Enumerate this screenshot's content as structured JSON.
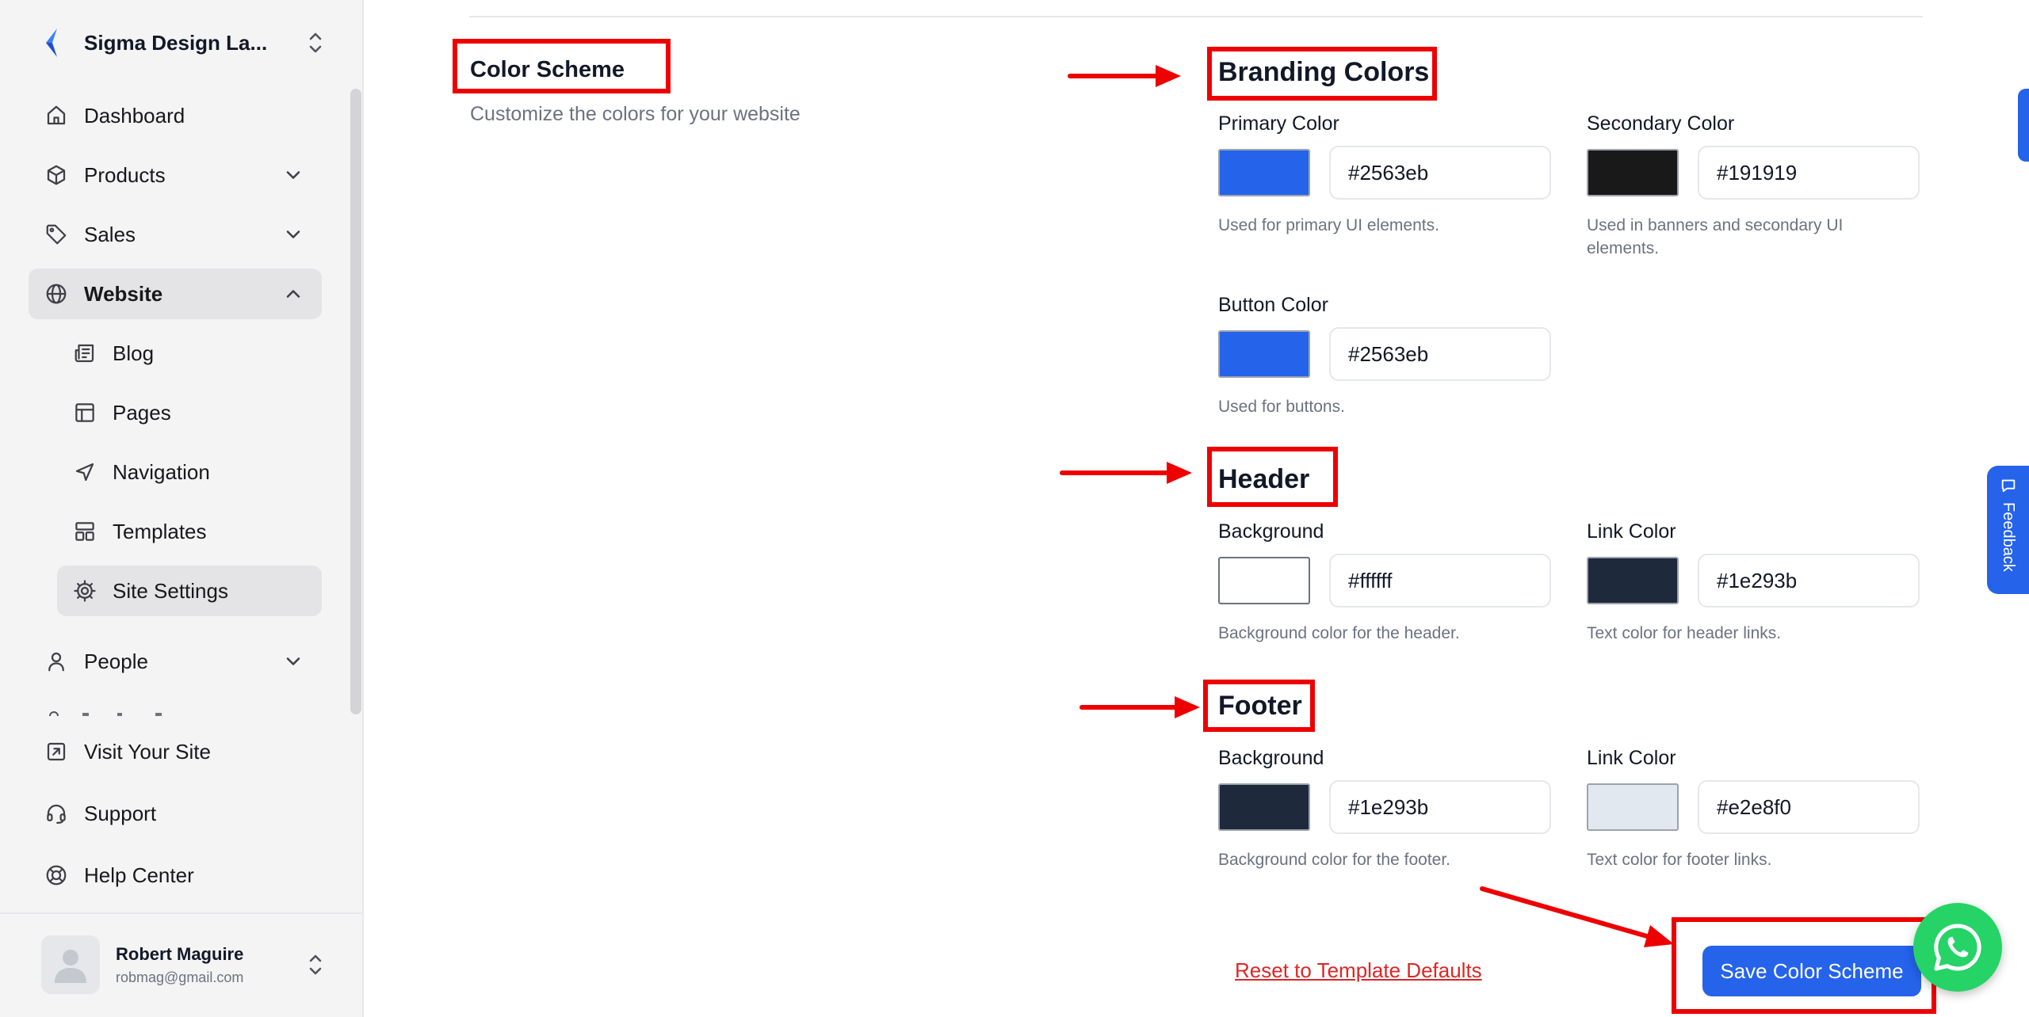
{
  "org": {
    "name": "Sigma Design La..."
  },
  "nav": {
    "dashboard": "Dashboard",
    "products": "Products",
    "sales": "Sales",
    "website": "Website",
    "blog": "Blog",
    "pages": "Pages",
    "navigation": "Navigation",
    "templates": "Templates",
    "site_settings": "Site Settings",
    "people": "People",
    "visit_site": "Visit Your Site",
    "support": "Support",
    "help_center": "Help Center"
  },
  "user": {
    "name": "Robert Maguire",
    "email": "robmag@gmail.com"
  },
  "section": {
    "title": "Color Scheme",
    "description": "Customize the colors for your website"
  },
  "branding": {
    "title": "Branding Colors",
    "primary": {
      "label": "Primary Color",
      "value": "#2563eb",
      "help": "Used for primary UI elements."
    },
    "secondary": {
      "label": "Secondary Color",
      "value": "#191919",
      "help": "Used in banners and secondary UI elements."
    },
    "button": {
      "label": "Button Color",
      "value": "#2563eb",
      "help": "Used for buttons."
    }
  },
  "header": {
    "title": "Header",
    "background": {
      "label": "Background",
      "value": "#ffffff",
      "help": "Background color for the header."
    },
    "link": {
      "label": "Link Color",
      "value": "#1e293b",
      "help": "Text color for header links."
    }
  },
  "footer": {
    "title": "Footer",
    "background": {
      "label": "Background",
      "value": "#1e293b",
      "help": "Background color for the footer."
    },
    "link": {
      "label": "Link Color",
      "value": "#e2e8f0",
      "help": "Text color for footer links."
    }
  },
  "actions": {
    "reset": "Reset to Template Defaults",
    "save": "Save Color Scheme"
  },
  "feedback": {
    "label": "Feedback"
  },
  "colors": {
    "accent": "#2563eb",
    "annotation": "#ee0000",
    "whatsapp": "#25d366"
  }
}
